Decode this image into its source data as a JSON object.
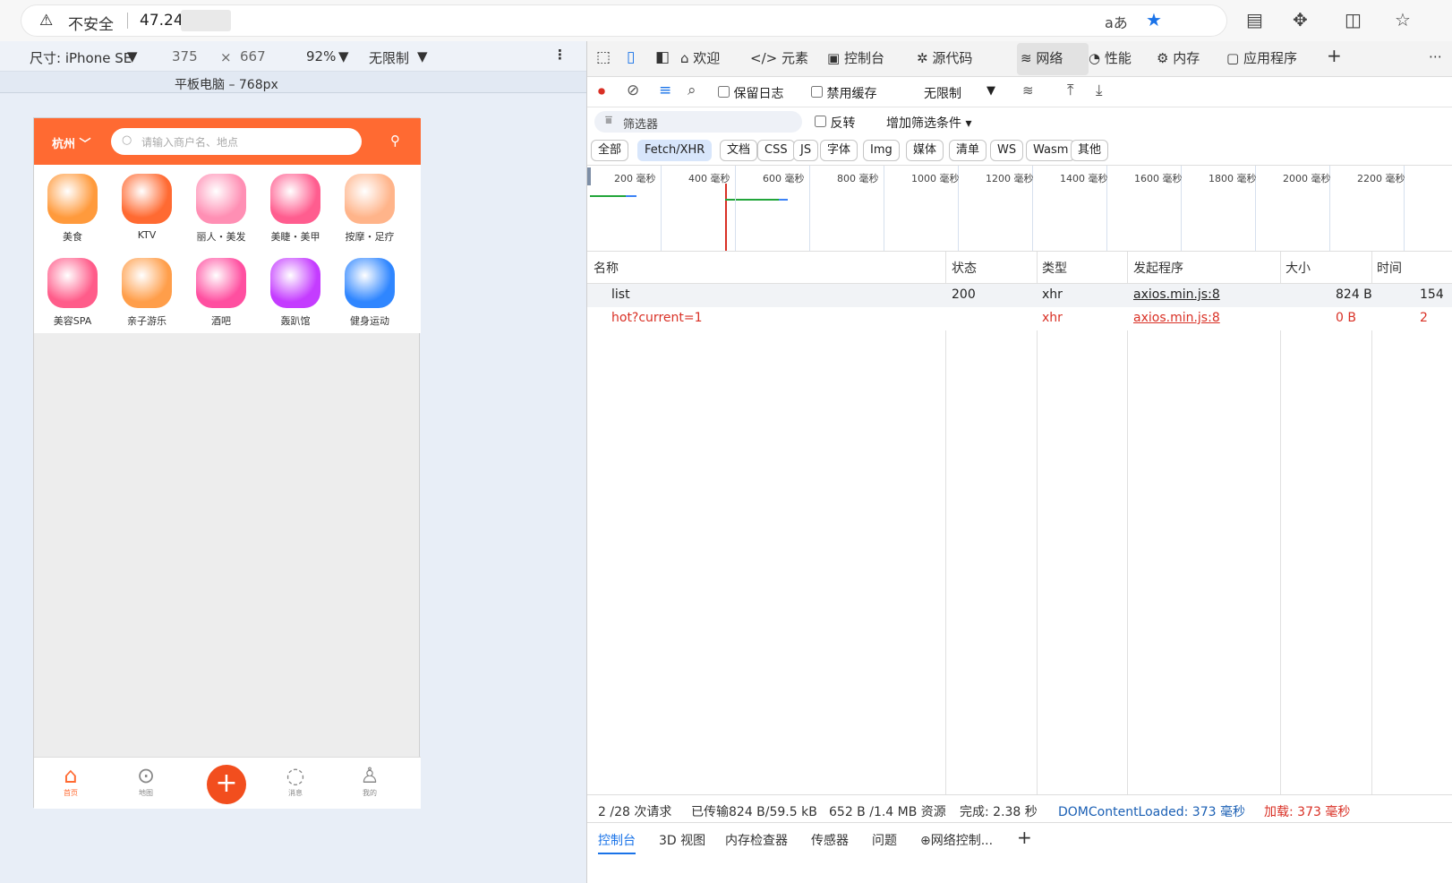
{
  "browser": {
    "security_label": "不安全",
    "url": "47.24",
    "translate_icon": "aあ",
    "icons": [
      "translate-icon",
      "star-icon",
      "reader-icon",
      "extensions-icon",
      "split-icon",
      "favorites-icon"
    ]
  },
  "emulation": {
    "device": "尺寸: iPhone SE",
    "width": "375",
    "times": "×",
    "height": "667",
    "zoom": "92%",
    "throttle": "无限制",
    "media_label": "平板电脑 – 768px"
  },
  "phone": {
    "city": "杭州",
    "search_placeholder": "请输入商户名、地点",
    "categories": [
      {
        "label": "美食",
        "color": "#ff9a3c"
      },
      {
        "label": "KTV",
        "color": "#ff6a32"
      },
      {
        "label": "丽人・美发",
        "color": "#ff8fb4"
      },
      {
        "label": "美睫・美甲",
        "color": "#ff5d8f"
      },
      {
        "label": "按摩・足疗",
        "color": "#ffb48a"
      },
      {
        "label": "美容SPA",
        "color": "#ff5c8a"
      },
      {
        "label": "亲子游乐",
        "color": "#ff9e4a"
      },
      {
        "label": "酒吧",
        "color": "#ff4fa0"
      },
      {
        "label": "轰趴馆",
        "color": "#c43cff"
      },
      {
        "label": "健身运动",
        "color": "#2f86ff"
      }
    ],
    "nav": [
      {
        "label": "首页"
      },
      {
        "label": "地图"
      },
      {
        "label": "消息"
      },
      {
        "label": "我的"
      }
    ]
  },
  "devtools": {
    "tabs": [
      "欢迎",
      "元素",
      "控制台",
      "源代码",
      "网络",
      "性能",
      "内存",
      "应用程序"
    ],
    "controls": {
      "preserve_log": "保留日志",
      "disable_cache": "禁用缓存",
      "throttle": "无限制"
    },
    "filter": {
      "placeholder": "筛选器",
      "invert": "反转",
      "more_filters": "增加筛选条件"
    },
    "types": [
      "全部",
      "Fetch/XHR",
      "文档",
      "CSS",
      "JS",
      "字体",
      "Img",
      "媒体",
      "清单",
      "WS",
      "Wasm",
      "其他"
    ],
    "timeline_ticks": [
      "200 毫秒",
      "400 毫秒",
      "600 毫秒",
      "800 毫秒",
      "1000 毫秒",
      "1200 毫秒",
      "1400 毫秒",
      "1600 毫秒",
      "1800 毫秒",
      "2000 毫秒",
      "2200 毫秒"
    ],
    "columns": [
      "名称",
      "状态",
      "类型",
      "发起程序",
      "大小",
      "时间"
    ],
    "rows": [
      {
        "name": "list",
        "status": "200",
        "type": "xhr",
        "initiator": "axios.min.js:8",
        "size": "824 B",
        "time": "154",
        "error": false
      },
      {
        "name": "hot?current=1",
        "status": "",
        "type": "xhr",
        "initiator": "axios.min.js:8",
        "size": "0 B",
        "time": "2",
        "error": true
      }
    ],
    "status": {
      "requests": "2 /28 次请求",
      "transferred": "已传输824 B/59.5 kB",
      "resources": "652 B /1.4 MB 资源",
      "finish": "完成: 2.38 秒",
      "dcl": "DOMContentLoaded: 373 毫秒",
      "load": "加载: 373 毫秒"
    },
    "drawer": [
      "控制台",
      "3D 视图",
      "内存检查器",
      "传感器",
      "问题",
      "网络控制..."
    ]
  },
  "colors": {
    "brand": "#ff6a32",
    "accent": "#1a73e8",
    "error": "#d93025"
  }
}
